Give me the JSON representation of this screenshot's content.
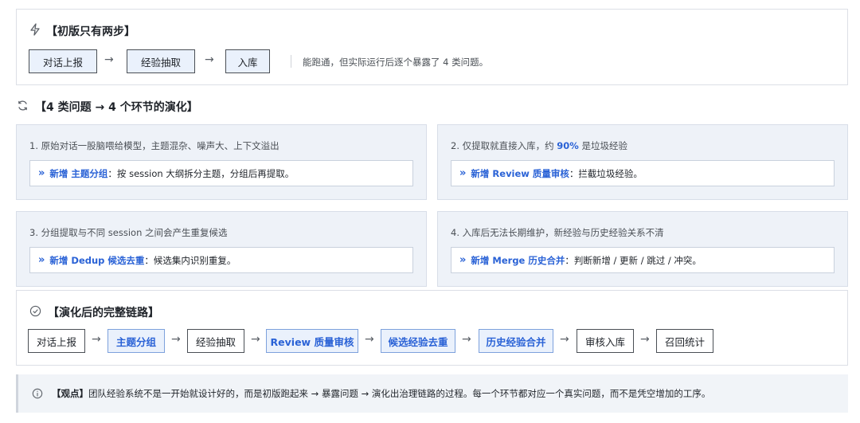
{
  "top": {
    "title": "【初版只有两步】",
    "steps": [
      "对话上报",
      "经验抽取",
      "入库"
    ],
    "arrow": "→",
    "note": "能跑通，但实际运行后逐个暴露了 4 类问题。"
  },
  "evolution": {
    "title": "【4 类问题 → 4 个环节的演化】",
    "cards": [
      {
        "problem": "1. 原始对话一股脑喂给模型，主题混杂、噪声大、上下文溢出",
        "problem_bold": "",
        "problem_after": "",
        "label": "新增 主题分组",
        "desc": "：按 session 大纲拆分主题，分组后再提取。"
      },
      {
        "problem": "2. 仅提取就直接入库，约 ",
        "problem_bold": "90%",
        "problem_after": " 是垃圾经验",
        "label": "新增 Review 质量审核",
        "desc": "：拦截垃圾经验。"
      },
      {
        "problem": "3. 分组提取与不同 session 之间会产生重复候选",
        "problem_bold": "",
        "problem_after": "",
        "label": "新增 Dedup 候选去重",
        "desc": "：候选集内识别重复。"
      },
      {
        "problem": "4. 入库后无法长期维护，新经验与历史经验关系不清",
        "problem_bold": "",
        "problem_after": "",
        "label": "新增 Merge 历史合并",
        "desc": "：判断新增 / 更新 / 跳过 / 冲突。"
      }
    ],
    "chevron": "»"
  },
  "final": {
    "title": "【演化后的完整链路】",
    "steps": [
      {
        "label": "对话上报",
        "hl": false
      },
      {
        "label": "主题分组",
        "hl": true
      },
      {
        "label": "经验抽取",
        "hl": false
      },
      {
        "label": "Review 质量审核",
        "hl": true
      },
      {
        "label": "候选经验去重",
        "hl": true
      },
      {
        "label": "历史经验合并",
        "hl": true
      },
      {
        "label": "审核入库",
        "hl": false
      },
      {
        "label": "召回统计",
        "hl": false
      }
    ]
  },
  "viewpoint": {
    "label": "【观点】",
    "text": "团队经验系统不是一开始就设计好的，而是初版跑起来 → 暴露问题 → 演化出治理链路的过程。每一个环节都对应一个真实问题，而不是凭空增加的工序。"
  },
  "icons": {
    "top": "lightning-icon",
    "evolution": "refresh-icon",
    "final": "check-circle-icon",
    "viewpoint": "info-icon"
  }
}
